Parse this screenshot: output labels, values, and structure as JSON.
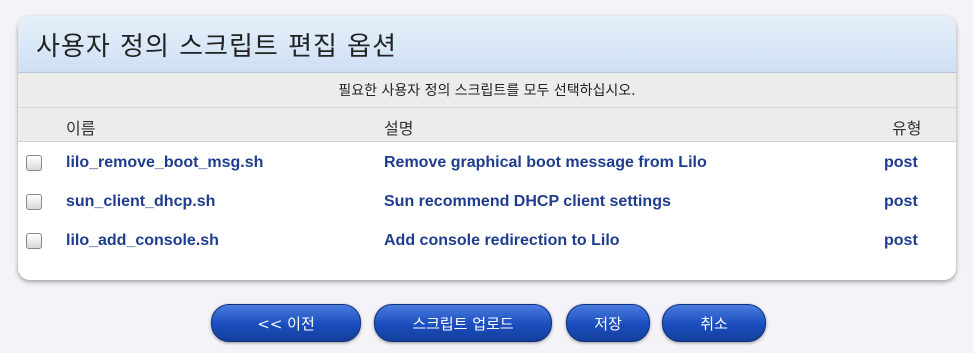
{
  "header": {
    "title": "사용자 정의 스크립트 편집 옵션"
  },
  "instructions": "필요한 사용자 정의 스크립트를 모두 선택하십시오.",
  "columns": {
    "name": "이름",
    "description": "설명",
    "type": "유형"
  },
  "scripts": [
    {
      "name": "lilo_remove_boot_msg.sh",
      "description": "Remove graphical boot message from Lilo",
      "type": "post",
      "checked": false
    },
    {
      "name": "sun_client_dhcp.sh",
      "description": "Sun recommend DHCP client settings",
      "type": "post",
      "checked": false
    },
    {
      "name": "lilo_add_console.sh",
      "description": "Add console redirection to Lilo",
      "type": "post",
      "checked": false
    }
  ],
  "buttons": {
    "previous": "<<  이전",
    "upload": "스크립트 업로드",
    "save": "저장",
    "cancel": "취소"
  },
  "colors": {
    "link_text": "#1f3d8e",
    "button": "#1a4dbd",
    "header_bg": "#dbe8f7"
  }
}
